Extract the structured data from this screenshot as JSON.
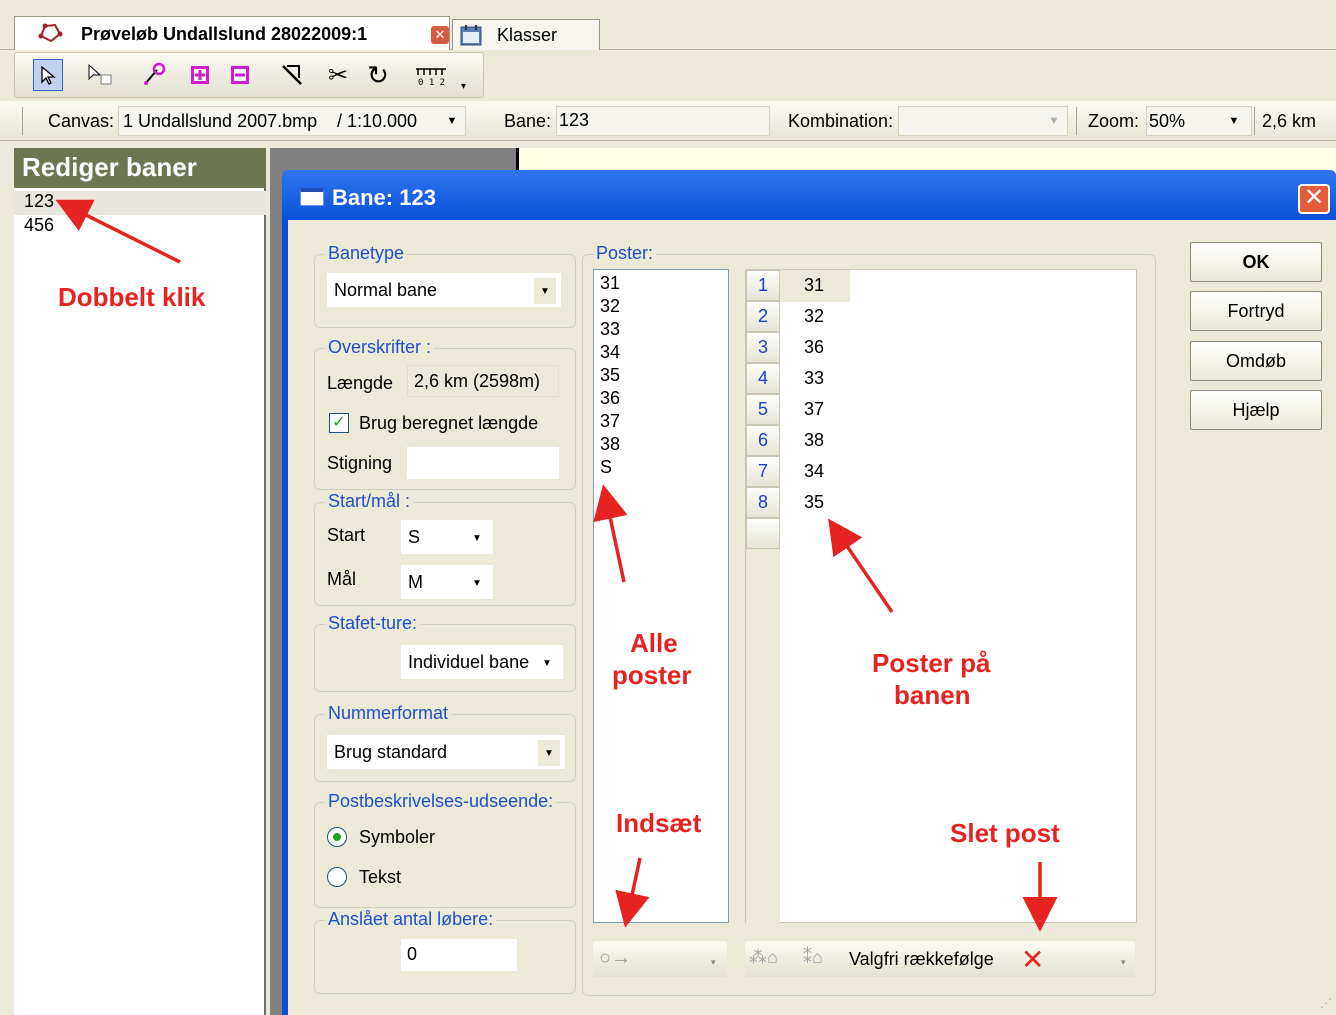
{
  "tabs": {
    "active_title": "Prøveløb Undallslund 28022009:1",
    "inactive_title": "Klasser"
  },
  "toolbar": {
    "buttons": [
      "select",
      "select-area",
      "draw-line",
      "add-control",
      "remove-control",
      "cut",
      "scissors",
      "rotate",
      "ruler"
    ]
  },
  "canvasbar": {
    "canvas_label": "Canvas:",
    "canvas_value": "1 Undallslund 2007.bmp",
    "scale_value": "/ 1:10.000",
    "bane_label": "Bane:",
    "bane_value": "123",
    "kombination_label": "Kombination:",
    "kombination_value": "",
    "zoom_label": "Zoom:",
    "zoom_value": "50%",
    "length_value": "2,6 km"
  },
  "leftpanel": {
    "title": "Rediger baner",
    "courses": [
      "123",
      "456"
    ]
  },
  "dialog": {
    "title": "Bane: 123",
    "banetype": {
      "label": "Banetype",
      "value": "Normal bane"
    },
    "overskrifter": {
      "label": "Overskrifter :",
      "laengde_label": "Længde",
      "laengde_value": "2,6 km (2598m)",
      "checkbox_label": "Brug beregnet længde",
      "checkbox_checked": true,
      "stigning_label": "Stigning",
      "stigning_value": ""
    },
    "startmaal": {
      "label": "Start/mål :",
      "start_label": "Start",
      "start_value": "S",
      "maal_label": "Mål",
      "maal_value": "M"
    },
    "stafet": {
      "label": "Stafet-ture:",
      "value": "Individuel bane"
    },
    "nummerformat": {
      "label": "Nummerformat",
      "value": "Brug standard"
    },
    "postbeskrivelse": {
      "label": "Postbeskrivelses-udseende:",
      "option1": "Symboler",
      "option2": "Tekst",
      "selected": "Symboler"
    },
    "antal": {
      "label": "Anslået antal løbere:",
      "value": "0"
    },
    "poster": {
      "label": "Poster:",
      "all": [
        "31",
        "32",
        "33",
        "34",
        "35",
        "36",
        "37",
        "38",
        "S"
      ],
      "course_rows": [
        {
          "num": "1",
          "value": "31"
        },
        {
          "num": "2",
          "value": "32"
        },
        {
          "num": "3",
          "value": "36"
        },
        {
          "num": "4",
          "value": "33"
        },
        {
          "num": "5",
          "value": "37"
        },
        {
          "num": "6",
          "value": "38"
        },
        {
          "num": "7",
          "value": "34"
        },
        {
          "num": "8",
          "value": "35"
        }
      ],
      "valgfri_label": "Valgfri rækkefølge"
    },
    "buttons": {
      "ok": "OK",
      "fortryd": "Fortryd",
      "omdoeb": "Omdøb",
      "hjaelp": "Hjælp"
    }
  },
  "annotations": {
    "dobbelt_klik": "Dobbelt klik",
    "alle_poster_1": "Alle",
    "alle_poster_2": "poster",
    "poster_paa_1": "Poster på",
    "poster_paa_2": "banen",
    "indsaet": "Indsæt",
    "slet_post": "Slet post"
  },
  "colors": {
    "annotation_red": "#e52421",
    "dialog_blue": "#0a50d8",
    "group_title_blue": "#1d50c9",
    "panel_header": "#6c7650"
  }
}
